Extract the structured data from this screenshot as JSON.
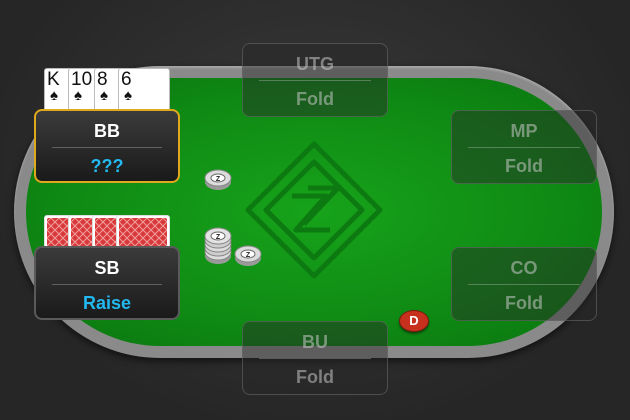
{
  "seats": {
    "utg": {
      "position": "UTG",
      "action": "Fold"
    },
    "mp": {
      "position": "MP",
      "action": "Fold"
    },
    "co": {
      "position": "CO",
      "action": "Fold"
    },
    "bu": {
      "position": "BU",
      "action": "Fold"
    },
    "sb": {
      "position": "SB",
      "action": "Raise"
    },
    "bb": {
      "position": "BB",
      "action": "???"
    }
  },
  "hero_hand": [
    {
      "rank": "K",
      "suit": "♠"
    },
    {
      "rank": "10",
      "suit": "♠"
    },
    {
      "rank": "8",
      "suit": "♠"
    },
    {
      "rank": "6",
      "suit": "♠"
    }
  ],
  "dealer_button": "D",
  "colors": {
    "felt": "#0f8a14",
    "to_act_border": "#e0a81d",
    "raise_text": "#22b8f0",
    "dealer_button": "#c8301e",
    "card_back": "#d8393a"
  },
  "icons": {
    "felt_logo": "diamond-logo-icon",
    "chip": "poker-chip-icon"
  }
}
